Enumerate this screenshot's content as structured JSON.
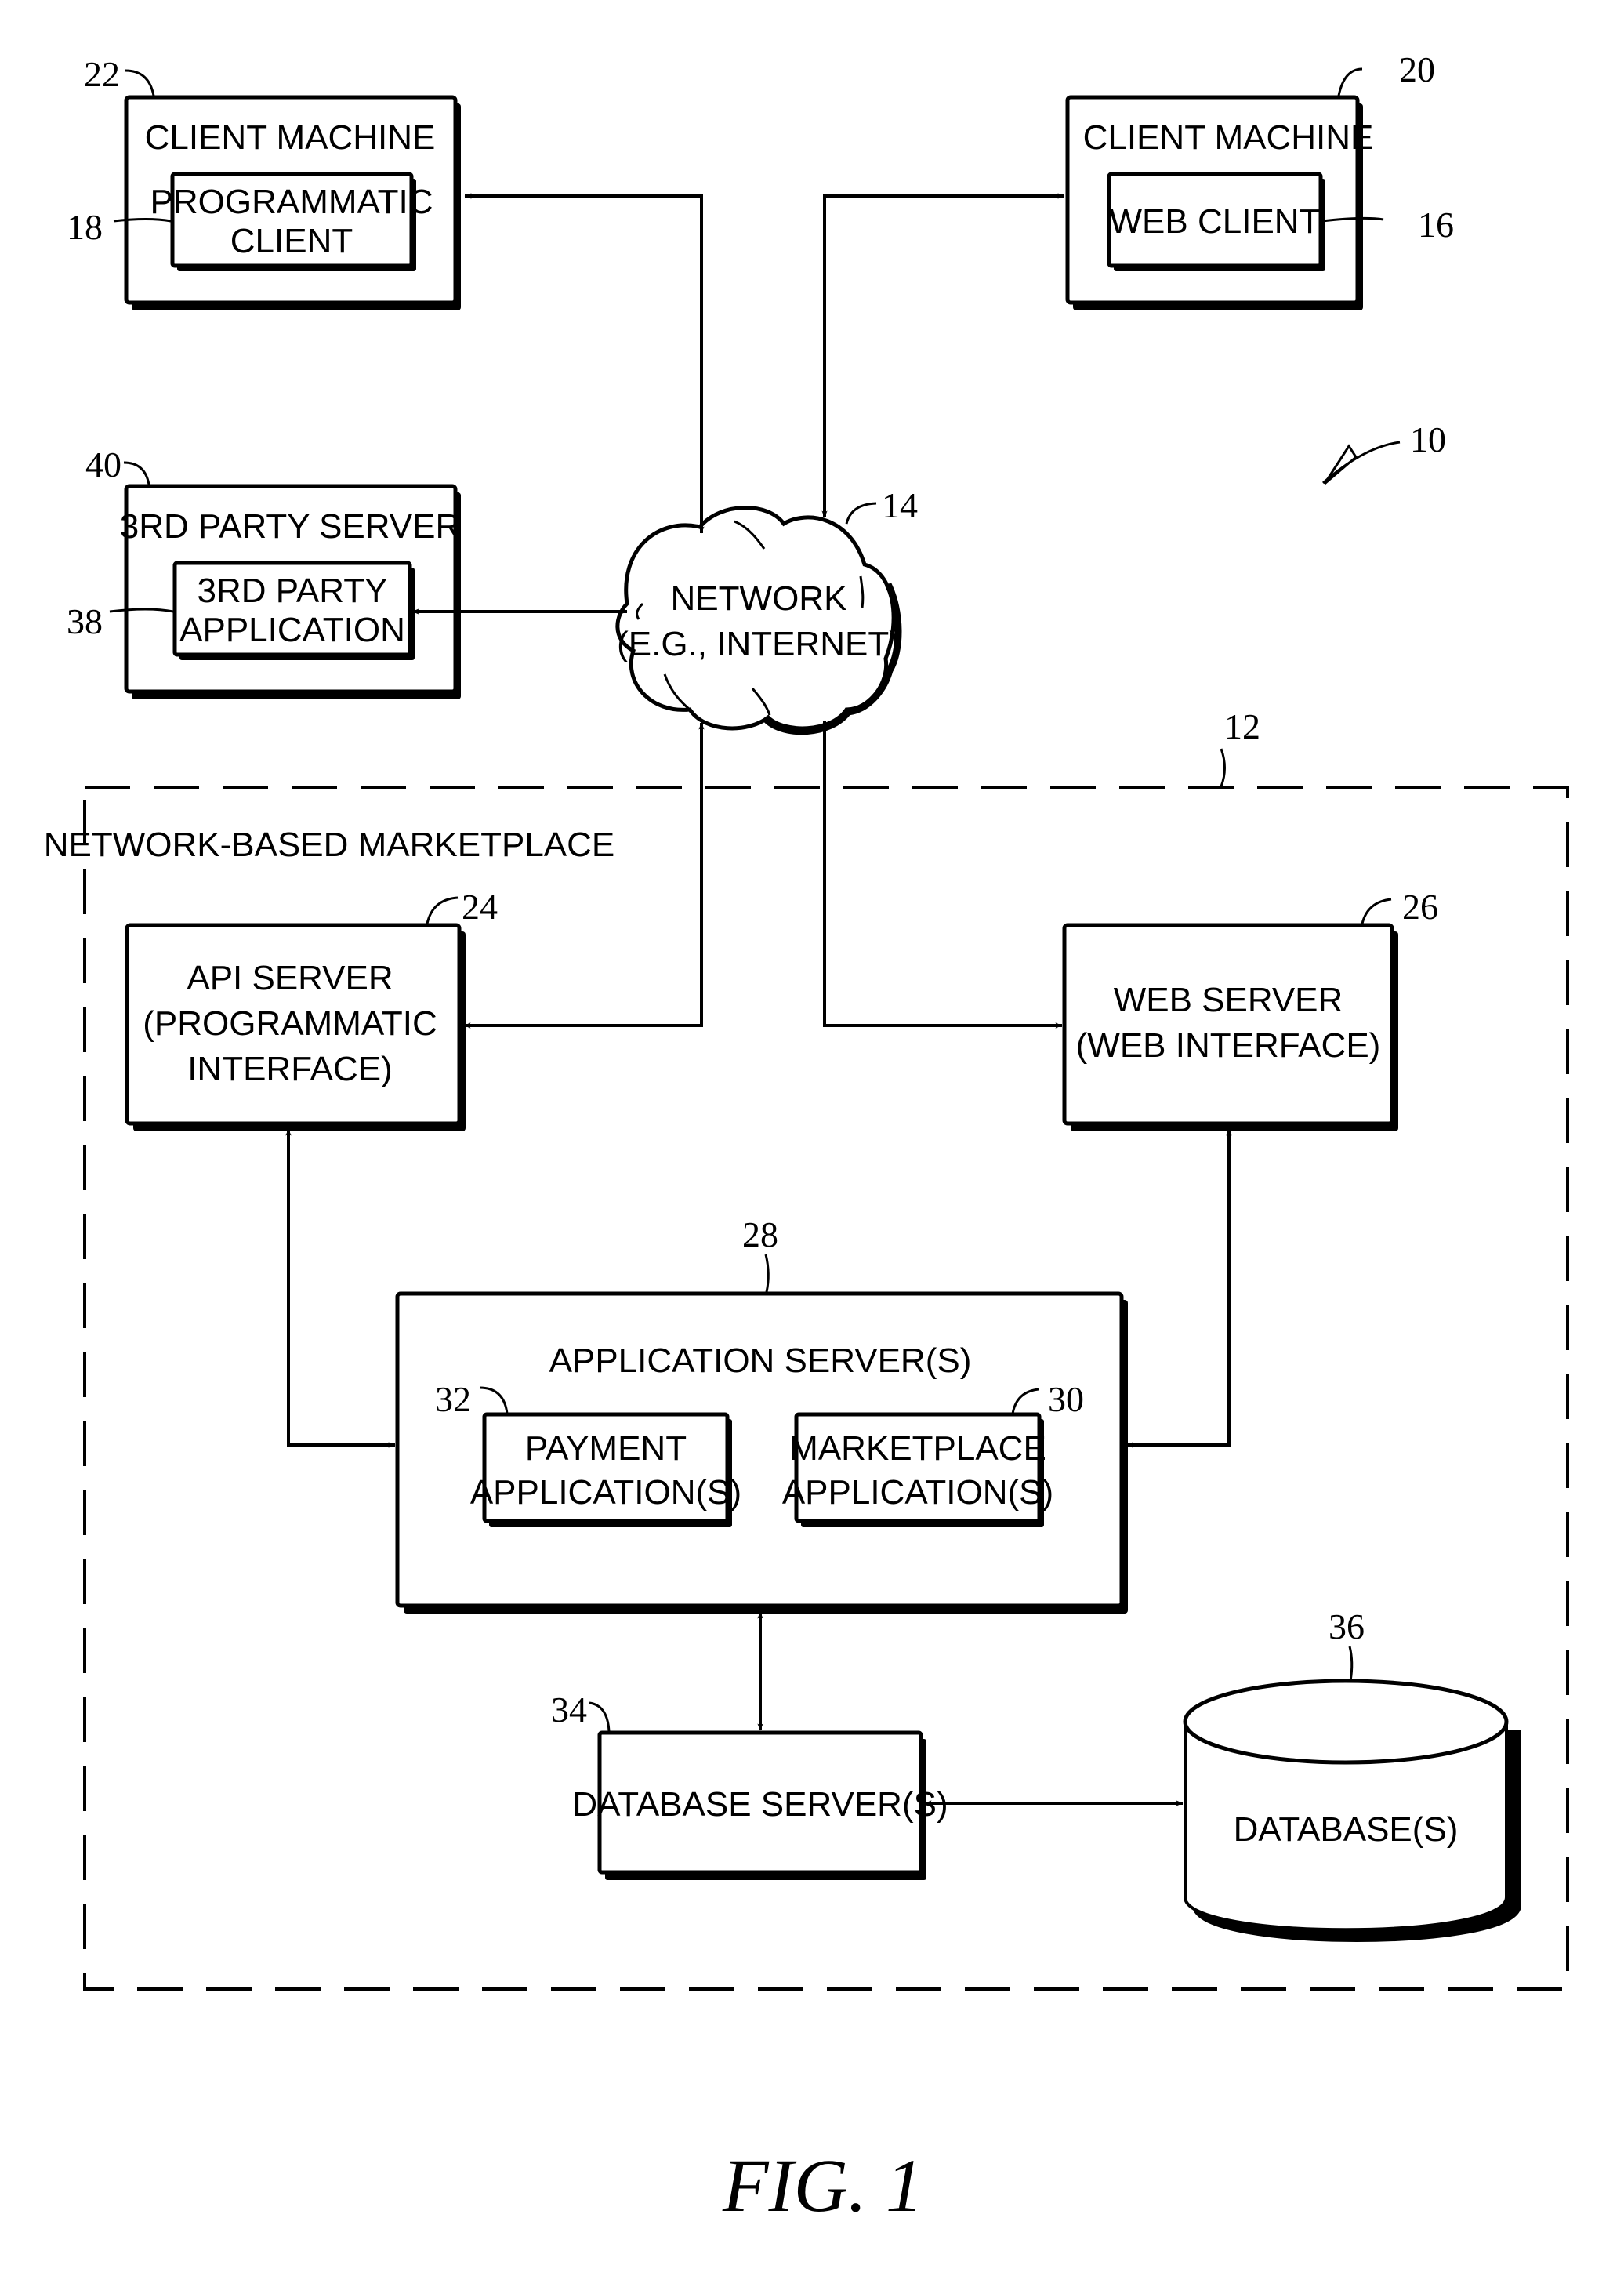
{
  "figure": {
    "caption": "FIG. 1",
    "system_ref": "10"
  },
  "nodes": {
    "client_machine_22": {
      "title": "CLIENT MACHINE",
      "ref": "22",
      "inner": {
        "lines": [
          "PROGRAMMATIC",
          "CLIENT"
        ],
        "ref": "18"
      }
    },
    "client_machine_20": {
      "title": "CLIENT MACHINE",
      "ref": "20",
      "inner": {
        "lines": [
          "WEB CLIENT"
        ],
        "ref": "16"
      }
    },
    "third_party_server": {
      "title": "3RD PARTY SERVER",
      "ref": "40",
      "inner": {
        "lines": [
          "3RD PARTY",
          "APPLICATION"
        ],
        "ref": "38"
      }
    },
    "network": {
      "lines": [
        "NETWORK",
        "(E.G., INTERNET)"
      ],
      "ref": "14"
    },
    "marketplace": {
      "title": "NETWORK-BASED MARKETPLACE",
      "ref": "12"
    },
    "api_server": {
      "lines": [
        "API SERVER",
        "(PROGRAMMATIC",
        "INTERFACE)"
      ],
      "ref": "24"
    },
    "web_server": {
      "lines": [
        "WEB SERVER",
        "(WEB INTERFACE)"
      ],
      "ref": "26"
    },
    "application_servers": {
      "title": "APPLICATION SERVER(S)",
      "ref": "28",
      "payment": {
        "lines": [
          "PAYMENT",
          "APPLICATION(S)"
        ],
        "ref": "32"
      },
      "marketplace_apps": {
        "lines": [
          "MARKETPLACE",
          "APPLICATION(S)"
        ],
        "ref": "30"
      }
    },
    "database_servers": {
      "lines": [
        "DATABASE SERVER(S)"
      ],
      "ref": "34"
    },
    "databases": {
      "lines": [
        "DATABASE(S)"
      ],
      "ref": "36"
    }
  },
  "connections": [
    {
      "from": "client_machine_22",
      "to": "network",
      "bidirectional": true
    },
    {
      "from": "client_machine_20",
      "to": "network",
      "bidirectional": true
    },
    {
      "from": "third_party_application",
      "to": "network",
      "bidirectional": true
    },
    {
      "from": "network",
      "to": "api_server",
      "bidirectional": true
    },
    {
      "from": "network",
      "to": "web_server",
      "bidirectional": true
    },
    {
      "from": "api_server",
      "to": "application_servers",
      "bidirectional": true
    },
    {
      "from": "web_server",
      "to": "application_servers",
      "bidirectional": true
    },
    {
      "from": "application_servers",
      "to": "database_servers",
      "bidirectional": true
    },
    {
      "from": "database_servers",
      "to": "databases",
      "bidirectional": true
    }
  ]
}
